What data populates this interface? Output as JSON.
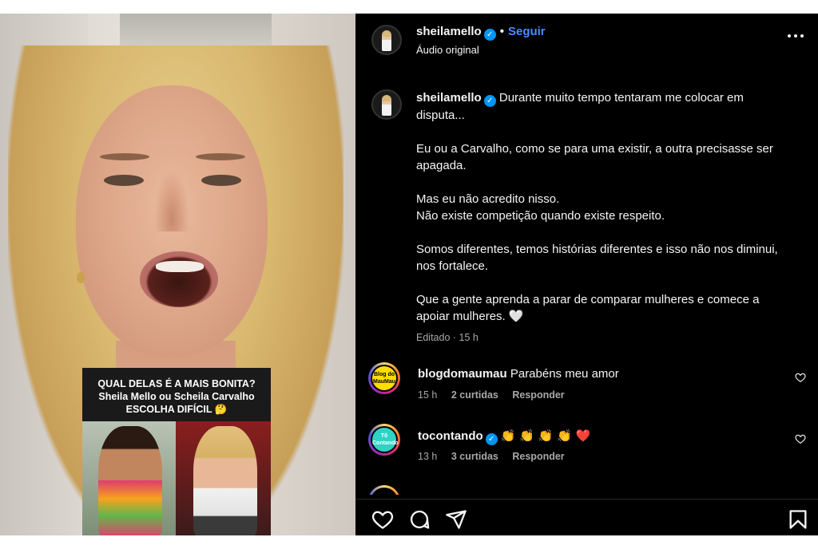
{
  "post": {
    "username": "sheilamello",
    "follow_label": "Seguir",
    "audio_label": "Áudio original",
    "separator": "•"
  },
  "caption": {
    "username": "sheilamello",
    "lines": [
      "Durante muito tempo tentaram me colocar em disputa...",
      "Eu ou a Carvalho, como se para uma existir, a outra precisasse ser apagada.",
      "Mas eu não acredito nisso.",
      "Não existe competição quando existe respeito.",
      "Somos diferentes, temos histórias diferentes e isso não nos diminui, nos fortalece.",
      "Que a gente aprenda a parar de comparar mulheres e comece a apoiar mulheres. 🤍"
    ],
    "edited": "Editado",
    "time": "15 h"
  },
  "comments": [
    {
      "username": "blogdomaumau",
      "text": "Parabéns meu amor",
      "time": "15 h",
      "likes": "2 curtidas",
      "reply": "Responder",
      "avatar_label": "Blog do MauMau"
    },
    {
      "username": "tocontando",
      "text": "👏 👏 👏 👏 ❤️",
      "time": "13 h",
      "likes": "3 curtidas",
      "reply": "Responder",
      "avatar_label": "Tô Contando"
    }
  ],
  "overlay": {
    "question_line1": "QUAL DELAS É A MAIS BONITA?",
    "question_line2": "Sheila Mello  ou Scheila Carvalho",
    "question_line3": "ESCOLHA DIFÍCIL 🤔"
  },
  "icons": {
    "like": "heart-icon",
    "comment": "comment-icon",
    "share": "send-icon",
    "save": "bookmark-icon",
    "more": "more-options-icon"
  },
  "colors": {
    "panel_bg": "#000000",
    "accent": "#4a8cff",
    "verified": "#0095f6",
    "muted": "#a8a8a8"
  }
}
